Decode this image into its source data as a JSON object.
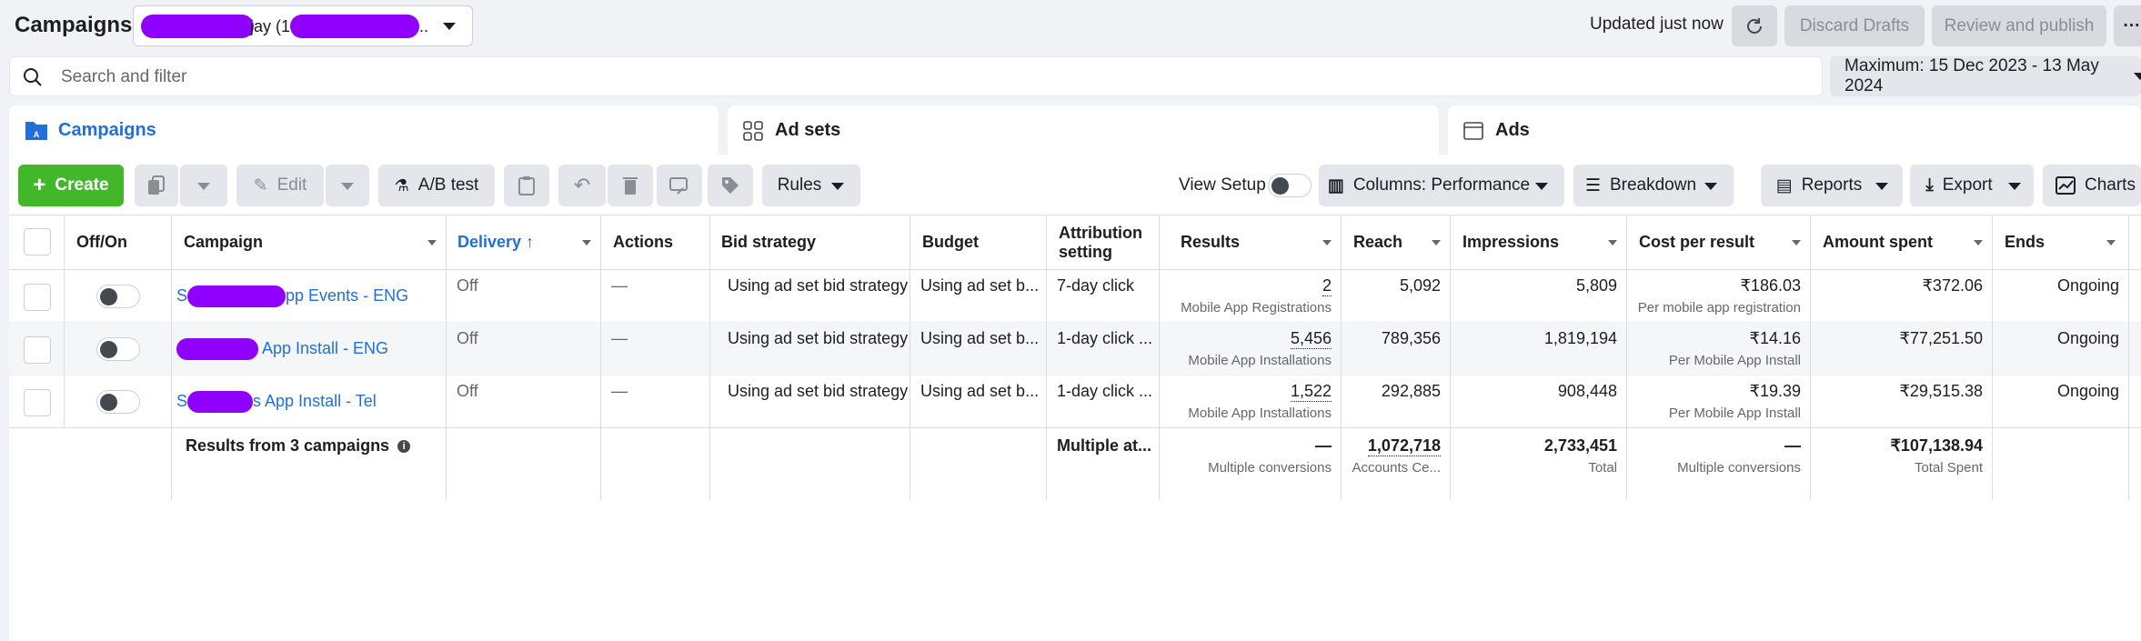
{
  "header": {
    "title": "Campaigns",
    "account_visible_text": "jay (13",
    "account_tail": "..",
    "updated": "Updated just now",
    "discard_label": "Discard Drafts",
    "publish_label": "Review and publish",
    "more_label": "···"
  },
  "search": {
    "placeholder": "Search and filter",
    "value": "",
    "date_range": "Maximum: 15 Dec 2023 - 13 May 2024"
  },
  "tabs": [
    {
      "label": "Campaigns",
      "active": true
    },
    {
      "label": "Ad sets",
      "active": false
    },
    {
      "label": "Ads",
      "active": false
    }
  ],
  "toolbar": {
    "create_label": "Create",
    "edit_label": "Edit",
    "ab_test_label": "A/B test",
    "rules_label": "Rules",
    "view_setup_label": "View Setup",
    "columns_label": "Columns: Performance",
    "breakdown_label": "Breakdown",
    "reports_label": "Reports",
    "export_label": "Export",
    "charts_label": "Charts"
  },
  "table": {
    "headers": {
      "off_on": "Off/On",
      "campaign": "Campaign",
      "delivery": "Delivery",
      "actions": "Actions",
      "bid_strategy": "Bid strategy",
      "budget": "Budget",
      "attribution_1": "Attribution",
      "attribution_2": "setting",
      "results": "Results",
      "reach": "Reach",
      "impressions": "Impressions",
      "cost_per_result": "Cost per result",
      "amount_spent": "Amount spent",
      "ends": "Ends"
    },
    "rows": [
      {
        "campaign_prefix": "S",
        "campaign_suffix": "pp Events - ENG",
        "delivery": "Off",
        "actions": "—",
        "bid_strategy": "Using ad set bid strategy",
        "budget": "Using ad set b...",
        "attribution": "7-day click",
        "results": "2",
        "results_sub": "Mobile App Registrations",
        "reach": "5,092",
        "impressions": "5,809",
        "cost_per_result": "₹186.03",
        "cost_sub": "Per mobile app registration",
        "amount_spent": "₹372.06",
        "ends": "Ongoing"
      },
      {
        "campaign_prefix": "",
        "campaign_suffix": "App Install - ENG",
        "delivery": "Off",
        "actions": "—",
        "bid_strategy": "Using ad set bid strategy",
        "budget": "Using ad set b...",
        "attribution": "1-day click ...",
        "results": "5,456",
        "results_sub": "Mobile App Installations",
        "reach": "789,356",
        "impressions": "1,819,194",
        "cost_per_result": "₹14.16",
        "cost_sub": "Per Mobile App Install",
        "amount_spent": "₹77,251.50",
        "ends": "Ongoing"
      },
      {
        "campaign_prefix": "S",
        "campaign_suffix": "s App Install - Tel",
        "delivery": "Off",
        "actions": "—",
        "bid_strategy": "Using ad set bid strategy",
        "budget": "Using ad set b...",
        "attribution": "1-day click ...",
        "results": "1,522",
        "results_sub": "Mobile App Installations",
        "reach": "292,885",
        "impressions": "908,448",
        "cost_per_result": "₹19.39",
        "cost_sub": "Per Mobile App Install",
        "amount_spent": "₹29,515.38",
        "ends": "Ongoing"
      }
    ],
    "summary": {
      "label": "Results from 3 campaigns",
      "attribution": "Multiple at...",
      "results": "—",
      "results_sub": "Multiple conversions",
      "reach": "1,072,718",
      "reach_sub": "Accounts Ce...",
      "impressions": "2,733,451",
      "impressions_sub": "Total",
      "cost_per_result": "—",
      "cost_sub": "Multiple conversions",
      "amount_spent": "₹107,138.94",
      "amount_sub": "Total Spent"
    }
  },
  "colors": {
    "accent_blue": "#216fdb",
    "create_green": "#42b72a",
    "redaction": "#8f00ff"
  }
}
